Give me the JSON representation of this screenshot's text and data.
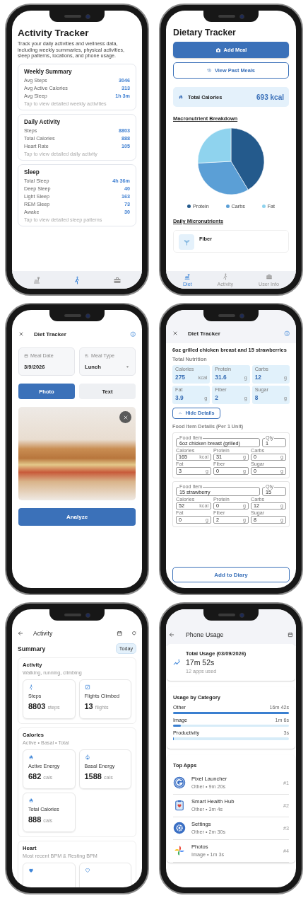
{
  "activity_tracker": {
    "title": "Activity Tracker",
    "description": "Track your daily activities and wellness data, including weekly summaries, physical activities, sleep patterns, locations, and phone usage.",
    "cards": [
      {
        "title": "Weekly Summary",
        "rows": [
          {
            "label": "Avg Steps",
            "value": "3046"
          },
          {
            "label": "Avg Active Calories",
            "value": "313"
          },
          {
            "label": "Avg Sleep",
            "value": "1h 3m"
          }
        ],
        "hint": "Tap to view detailed weekly activities"
      },
      {
        "title": "Daily Activity",
        "rows": [
          {
            "label": "Steps",
            "value": "8803"
          },
          {
            "label": "Total Calories",
            "value": "888"
          },
          {
            "label": "Heart Rate",
            "value": "105"
          }
        ],
        "hint": "Tap to view detailed daily activity"
      },
      {
        "title": "Sleep",
        "rows": [
          {
            "label": "Total Sleep",
            "value": "4h 36m"
          },
          {
            "label": "Deep Sleep",
            "value": "40"
          },
          {
            "label": "Light Sleep",
            "value": "163"
          },
          {
            "label": "REM Sleep",
            "value": "73"
          },
          {
            "label": "Awake",
            "value": "30"
          }
        ],
        "hint": "Tap to view detailed sleep patterns"
      }
    ],
    "nav": [
      {
        "kind": "diet",
        "selected": false
      },
      {
        "kind": "activity",
        "selected": true
      },
      {
        "kind": "user",
        "selected": false
      }
    ]
  },
  "dietary_tracker": {
    "title": "Dietary Tracker",
    "add_button": "Add Meal",
    "history_button": "View Past Meals",
    "total_label": "Total Calories",
    "total_value": "693 kcal",
    "macro_title": "Macronutrient Breakdown",
    "legend": [
      {
        "label": "Protein",
        "color": "#245a8c"
      },
      {
        "label": "Carbs",
        "color": "#5b9fd6"
      },
      {
        "label": "Fat",
        "color": "#8fd3ee"
      }
    ],
    "micro_title": "Daily Micronutrients",
    "micro_items": [
      {
        "name": "Fiber"
      }
    ],
    "nav": [
      {
        "kind": "diet",
        "label": "Diet",
        "selected": true
      },
      {
        "kind": "activity",
        "label": "Activity",
        "selected": false
      },
      {
        "kind": "user",
        "label": "User Info",
        "selected": false
      }
    ]
  },
  "meal_entry": {
    "title": "Diet Tracker",
    "fields": [
      {
        "kind": "date",
        "label": "Meal Date",
        "value": "3/9/2026"
      },
      {
        "kind": "select",
        "label": "Meal Type",
        "value": "Lunch"
      }
    ],
    "modes": [
      {
        "label": "Photo",
        "selected": true
      },
      {
        "label": "Text",
        "selected": false
      }
    ],
    "action_button": "Analyze"
  },
  "meal_analysis": {
    "title": "Diet Tracker",
    "meal_name": "6oz grilled chicken breast and 15 strawberries",
    "totals_title": "Total Nutrition",
    "totals": [
      {
        "label": "Calories",
        "value": "275",
        "unit": "kcal"
      },
      {
        "label": "Protein",
        "value": "31.6",
        "unit": "g"
      },
      {
        "label": "Carbs",
        "value": "12",
        "unit": "g"
      },
      {
        "label": "Fat",
        "value": "3.9",
        "unit": "g"
      },
      {
        "label": "Fiber",
        "value": "2",
        "unit": "g"
      },
      {
        "label": "Sugar",
        "value": "8",
        "unit": "g"
      }
    ],
    "toggle_button": "Hide Details",
    "details_expanded": true,
    "details_title": "Food Item Details (Per 1 Unit)",
    "items": [
      {
        "name_label": "Food Item",
        "name": "6oz chicken breast (grilled)",
        "qty_label": "Qty",
        "qty": "1",
        "fields": [
          {
            "label": "Calories",
            "value": "165",
            "unit": "kcal"
          },
          {
            "label": "Protein",
            "value": "31",
            "unit": "g"
          },
          {
            "label": "Carbs",
            "value": "0",
            "unit": "g"
          },
          {
            "label": "Fat",
            "value": "3",
            "unit": "g"
          },
          {
            "label": "Fiber",
            "value": "0",
            "unit": "g"
          },
          {
            "label": "Sugar",
            "value": "0",
            "unit": "g"
          }
        ]
      },
      {
        "name_label": "Food Item",
        "name": "15 strawberry",
        "qty_label": "Qty",
        "qty": "15",
        "fields": [
          {
            "label": "Calories",
            "value": "52",
            "unit": "kcal"
          },
          {
            "label": "Protein",
            "value": "0",
            "unit": "g"
          },
          {
            "label": "Carbs",
            "value": "12",
            "unit": "g"
          },
          {
            "label": "Fat",
            "value": "0",
            "unit": "g"
          },
          {
            "label": "Fiber",
            "value": "2",
            "unit": "g"
          },
          {
            "label": "Sugar",
            "value": "8",
            "unit": "g"
          }
        ]
      }
    ],
    "action_button": "Add to Diary"
  },
  "activity_summary": {
    "title": "Activity",
    "summary_title": "Summary",
    "period": "Today",
    "groups": [
      {
        "title": "Activity",
        "subtitle": "Walking, running, climbing",
        "tiles": [
          {
            "kind": "steps",
            "label": "Steps",
            "value": "8803",
            "unit": "steps"
          },
          {
            "kind": "flights",
            "label": "Flights Climbed",
            "value": "13",
            "unit": "flights"
          }
        ]
      },
      {
        "title": "Calories",
        "subtitle": "Active • Basal • Total",
        "tiles": [
          {
            "kind": "active",
            "label": "Active Energy",
            "value": "682",
            "unit": "cals"
          },
          {
            "kind": "basal",
            "label": "Basal Energy",
            "value": "1588",
            "unit": "cals"
          },
          {
            "kind": "active",
            "label": "Total Calories",
            "value": "888",
            "unit": "cals"
          }
        ]
      },
      {
        "title": "Heart",
        "subtitle": "Most recent BPM & Resting BPM",
        "tiles": [
          {
            "kind": "recent"
          },
          {
            "kind": "resting"
          }
        ]
      }
    ]
  },
  "phone_usage": {
    "title": "Phone Usage",
    "total_label": "Total Usage (03/09/2026)",
    "total_value": "17m 52s",
    "total_note": "12 apps used",
    "category_title": "Usage by Category",
    "categories": [
      {
        "name": "Other",
        "time": "16m 42s",
        "level": 1
      },
      {
        "name": "Image",
        "time": "1m 6s",
        "level": 0.066
      },
      {
        "name": "Productivity",
        "time": "3s",
        "level": 0.005
      }
    ],
    "apps_title": "Top Apps",
    "apps": [
      {
        "name": "Pixel Launcher",
        "detail": "Other • 9m 20s",
        "rank": "#1"
      },
      {
        "name": "Smart Health Hub",
        "detail": "Other • 3m 4s",
        "rank": "#2"
      },
      {
        "name": "Settings",
        "detail": "Other • 2m 30s",
        "rank": "#3"
      },
      {
        "name": "Photos",
        "detail": "Image • 1m 3s",
        "rank": "#4"
      }
    ]
  }
}
